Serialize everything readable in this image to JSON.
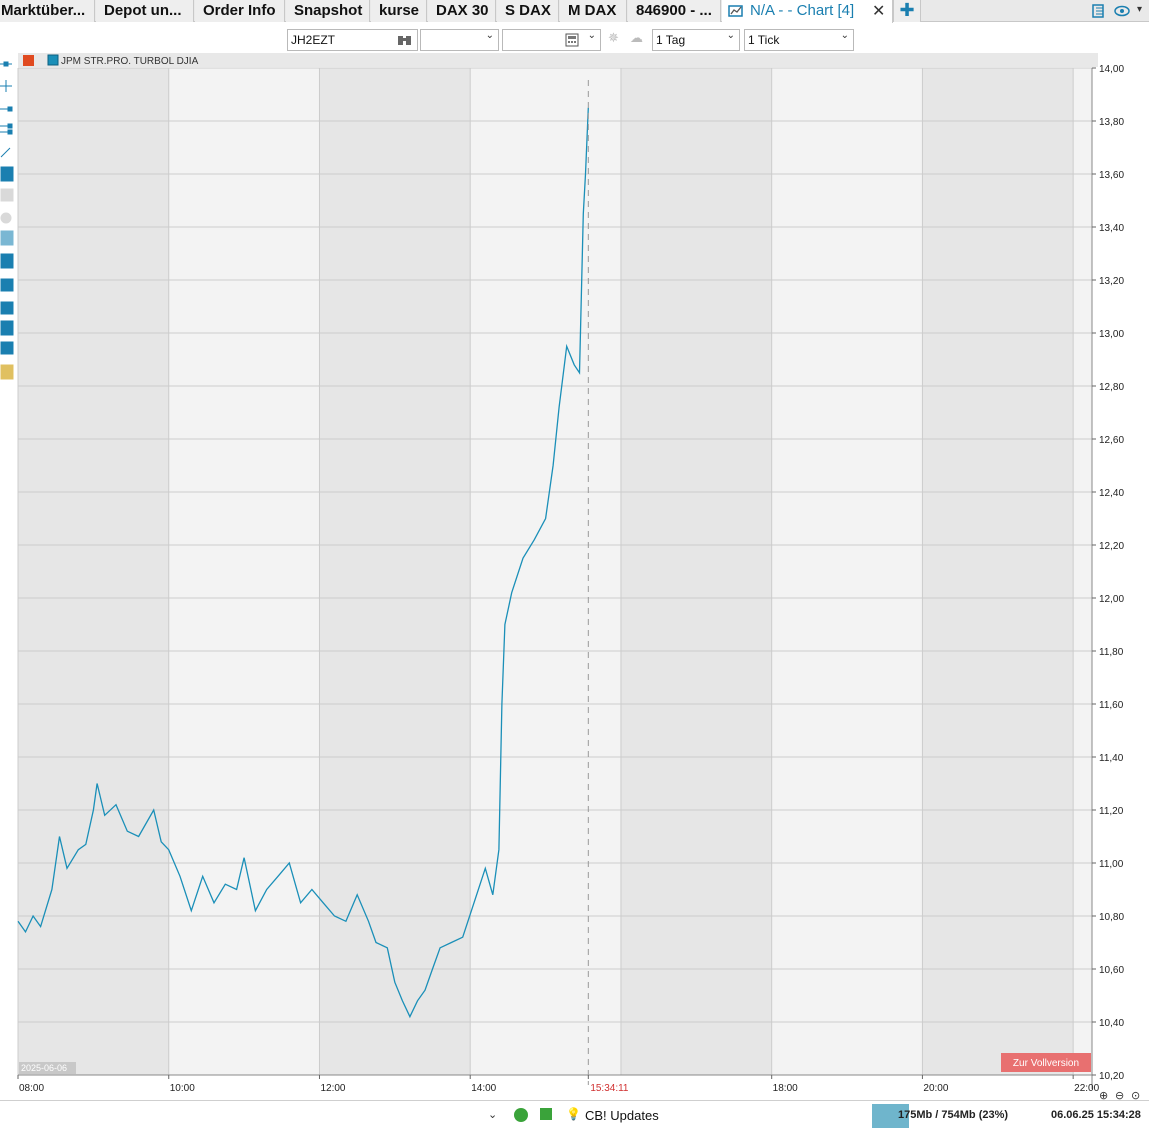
{
  "tabs": [
    {
      "label": "Marktüber..."
    },
    {
      "label": "Depot un..."
    },
    {
      "label": "Order Info"
    },
    {
      "label": "Snapshot"
    },
    {
      "label": "kurse"
    },
    {
      "label": "DAX 30"
    },
    {
      "label": "S DAX"
    },
    {
      "label": "M DAX"
    },
    {
      "label": "846900 - ..."
    },
    {
      "label": "N/A -  - Chart [4]"
    }
  ],
  "toolbar": {
    "symbol_value": "JH2EZT",
    "period_value": "1 Tag",
    "resolution_value": "1 Tick"
  },
  "instrument": {
    "name": "JPM STR.PRO. TURBOL DJIA",
    "color": "#1a8fb8"
  },
  "chart": {
    "date_label": "2025-06-06",
    "current_time_label": "15:34:11",
    "full_version_button": "Zur Vollversion"
  },
  "chart_data": {
    "type": "line",
    "title": "JPM STR.PRO. TURBOL DJIA",
    "xlabel": "",
    "ylabel": "",
    "x_ticks": [
      "08:00",
      "10:00",
      "12:00",
      "14:00",
      "15:34:11",
      "18:00",
      "20:00",
      "22:00"
    ],
    "y_ticks": [
      "14,00",
      "13,80",
      "13,60",
      "13,40",
      "13,20",
      "13,00",
      "12,80",
      "12,60",
      "12,40",
      "12,20",
      "12,00",
      "11,80",
      "11,60",
      "11,40",
      "11,20",
      "11,00",
      "10,80",
      "10,60",
      "10,40",
      "10,20"
    ],
    "ylim": [
      10.2,
      14.0
    ],
    "xlim_hours": [
      8.0,
      22.25
    ],
    "grid": true,
    "series": [
      {
        "name": "JPM STR.PRO. TURBOL DJIA",
        "points": [
          [
            8.0,
            10.78
          ],
          [
            8.1,
            10.74
          ],
          [
            8.2,
            10.8
          ],
          [
            8.3,
            10.76
          ],
          [
            8.45,
            10.9
          ],
          [
            8.55,
            11.1
          ],
          [
            8.65,
            10.98
          ],
          [
            8.8,
            11.05
          ],
          [
            8.9,
            11.07
          ],
          [
            9.0,
            11.2
          ],
          [
            9.05,
            11.3
          ],
          [
            9.15,
            11.18
          ],
          [
            9.3,
            11.22
          ],
          [
            9.45,
            11.12
          ],
          [
            9.6,
            11.1
          ],
          [
            9.8,
            11.2
          ],
          [
            9.9,
            11.08
          ],
          [
            10.0,
            11.05
          ],
          [
            10.15,
            10.95
          ],
          [
            10.3,
            10.82
          ],
          [
            10.45,
            10.95
          ],
          [
            10.6,
            10.85
          ],
          [
            10.75,
            10.92
          ],
          [
            10.9,
            10.9
          ],
          [
            11.0,
            11.02
          ],
          [
            11.15,
            10.82
          ],
          [
            11.3,
            10.9
          ],
          [
            11.45,
            10.95
          ],
          [
            11.6,
            11.0
          ],
          [
            11.75,
            10.85
          ],
          [
            11.9,
            10.9
          ],
          [
            12.05,
            10.85
          ],
          [
            12.2,
            10.8
          ],
          [
            12.35,
            10.78
          ],
          [
            12.5,
            10.88
          ],
          [
            12.65,
            10.78
          ],
          [
            12.75,
            10.7
          ],
          [
            12.9,
            10.68
          ],
          [
            13.0,
            10.55
          ],
          [
            13.1,
            10.48
          ],
          [
            13.2,
            10.42
          ],
          [
            13.3,
            10.48
          ],
          [
            13.4,
            10.52
          ],
          [
            13.5,
            10.6
          ],
          [
            13.6,
            10.68
          ],
          [
            13.75,
            10.7
          ],
          [
            13.9,
            10.72
          ],
          [
            14.05,
            10.85
          ],
          [
            14.2,
            10.98
          ],
          [
            14.3,
            10.88
          ],
          [
            14.38,
            11.05
          ],
          [
            14.42,
            11.6
          ],
          [
            14.46,
            11.9
          ],
          [
            14.55,
            12.02
          ],
          [
            14.7,
            12.15
          ],
          [
            14.85,
            12.22
          ],
          [
            15.0,
            12.3
          ],
          [
            15.1,
            12.5
          ],
          [
            15.18,
            12.72
          ],
          [
            15.28,
            12.95
          ],
          [
            15.38,
            12.88
          ],
          [
            15.45,
            12.85
          ],
          [
            15.5,
            13.45
          ],
          [
            15.53,
            13.6
          ],
          [
            15.567,
            13.85
          ]
        ]
      }
    ]
  },
  "status_bar": {
    "updates_label": "CB! Updates",
    "memory_label": "175Mb / 754Mb (23%)",
    "datetime": "06.06.25 15:34:28"
  },
  "colors": {
    "accent": "#1a7fb0",
    "line": "#1a8fb8",
    "shade": "#e6e6e6",
    "button_red": "#e87070",
    "time_red": "#d03030",
    "status_green": "#3aa33a"
  },
  "icons": [
    "calculator-icon",
    "chevron-down-icon",
    "close-icon",
    "add-icon",
    "settings-icon",
    "eye-icon",
    "zoom-in-icon",
    "zoom-out-icon",
    "zoom-reset-icon",
    "lightbulb-icon"
  ]
}
